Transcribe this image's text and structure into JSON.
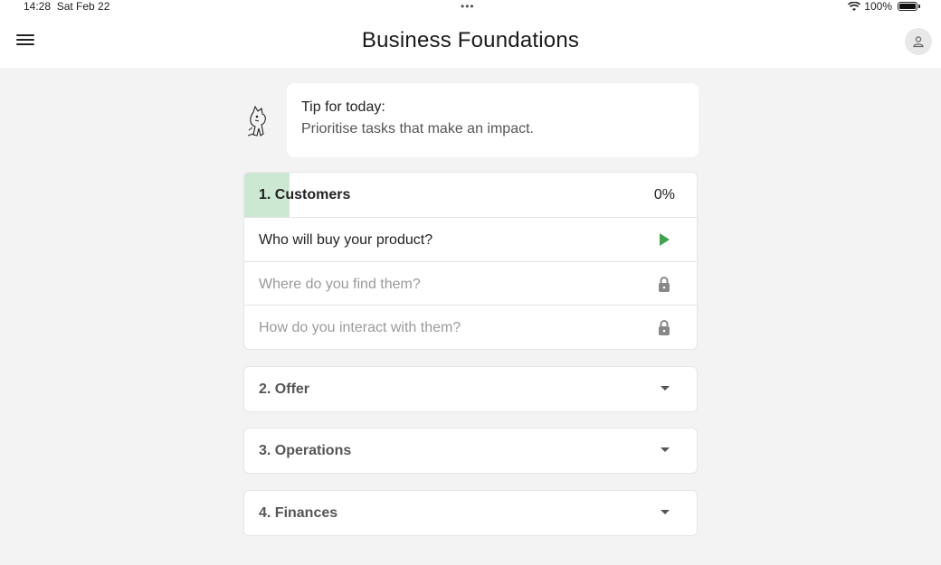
{
  "status_bar": {
    "time": "14:28",
    "date": "Sat Feb 22",
    "battery": "100%"
  },
  "header": {
    "title": "Business Foundations"
  },
  "tip": {
    "title": "Tip for today:",
    "text": "Prioritise tasks that make an impact."
  },
  "sections": [
    {
      "title": "1. Customers",
      "percent": "0%",
      "progress": 0.1,
      "tasks": [
        {
          "label": "Who will buy your product?",
          "state": "active",
          "icon": "play-icon"
        },
        {
          "label": "Where do you find them?",
          "state": "locked",
          "icon": "lock-icon"
        },
        {
          "label": "How do you interact with them?",
          "state": "locked",
          "icon": "lock-icon"
        }
      ]
    },
    {
      "title": "2. Offer"
    },
    {
      "title": "3. Operations"
    },
    {
      "title": "4. Finances"
    }
  ],
  "colors": {
    "accent": "#3fa34d",
    "progress_fill": "#cde8d2",
    "background": "#f3f3f3"
  }
}
